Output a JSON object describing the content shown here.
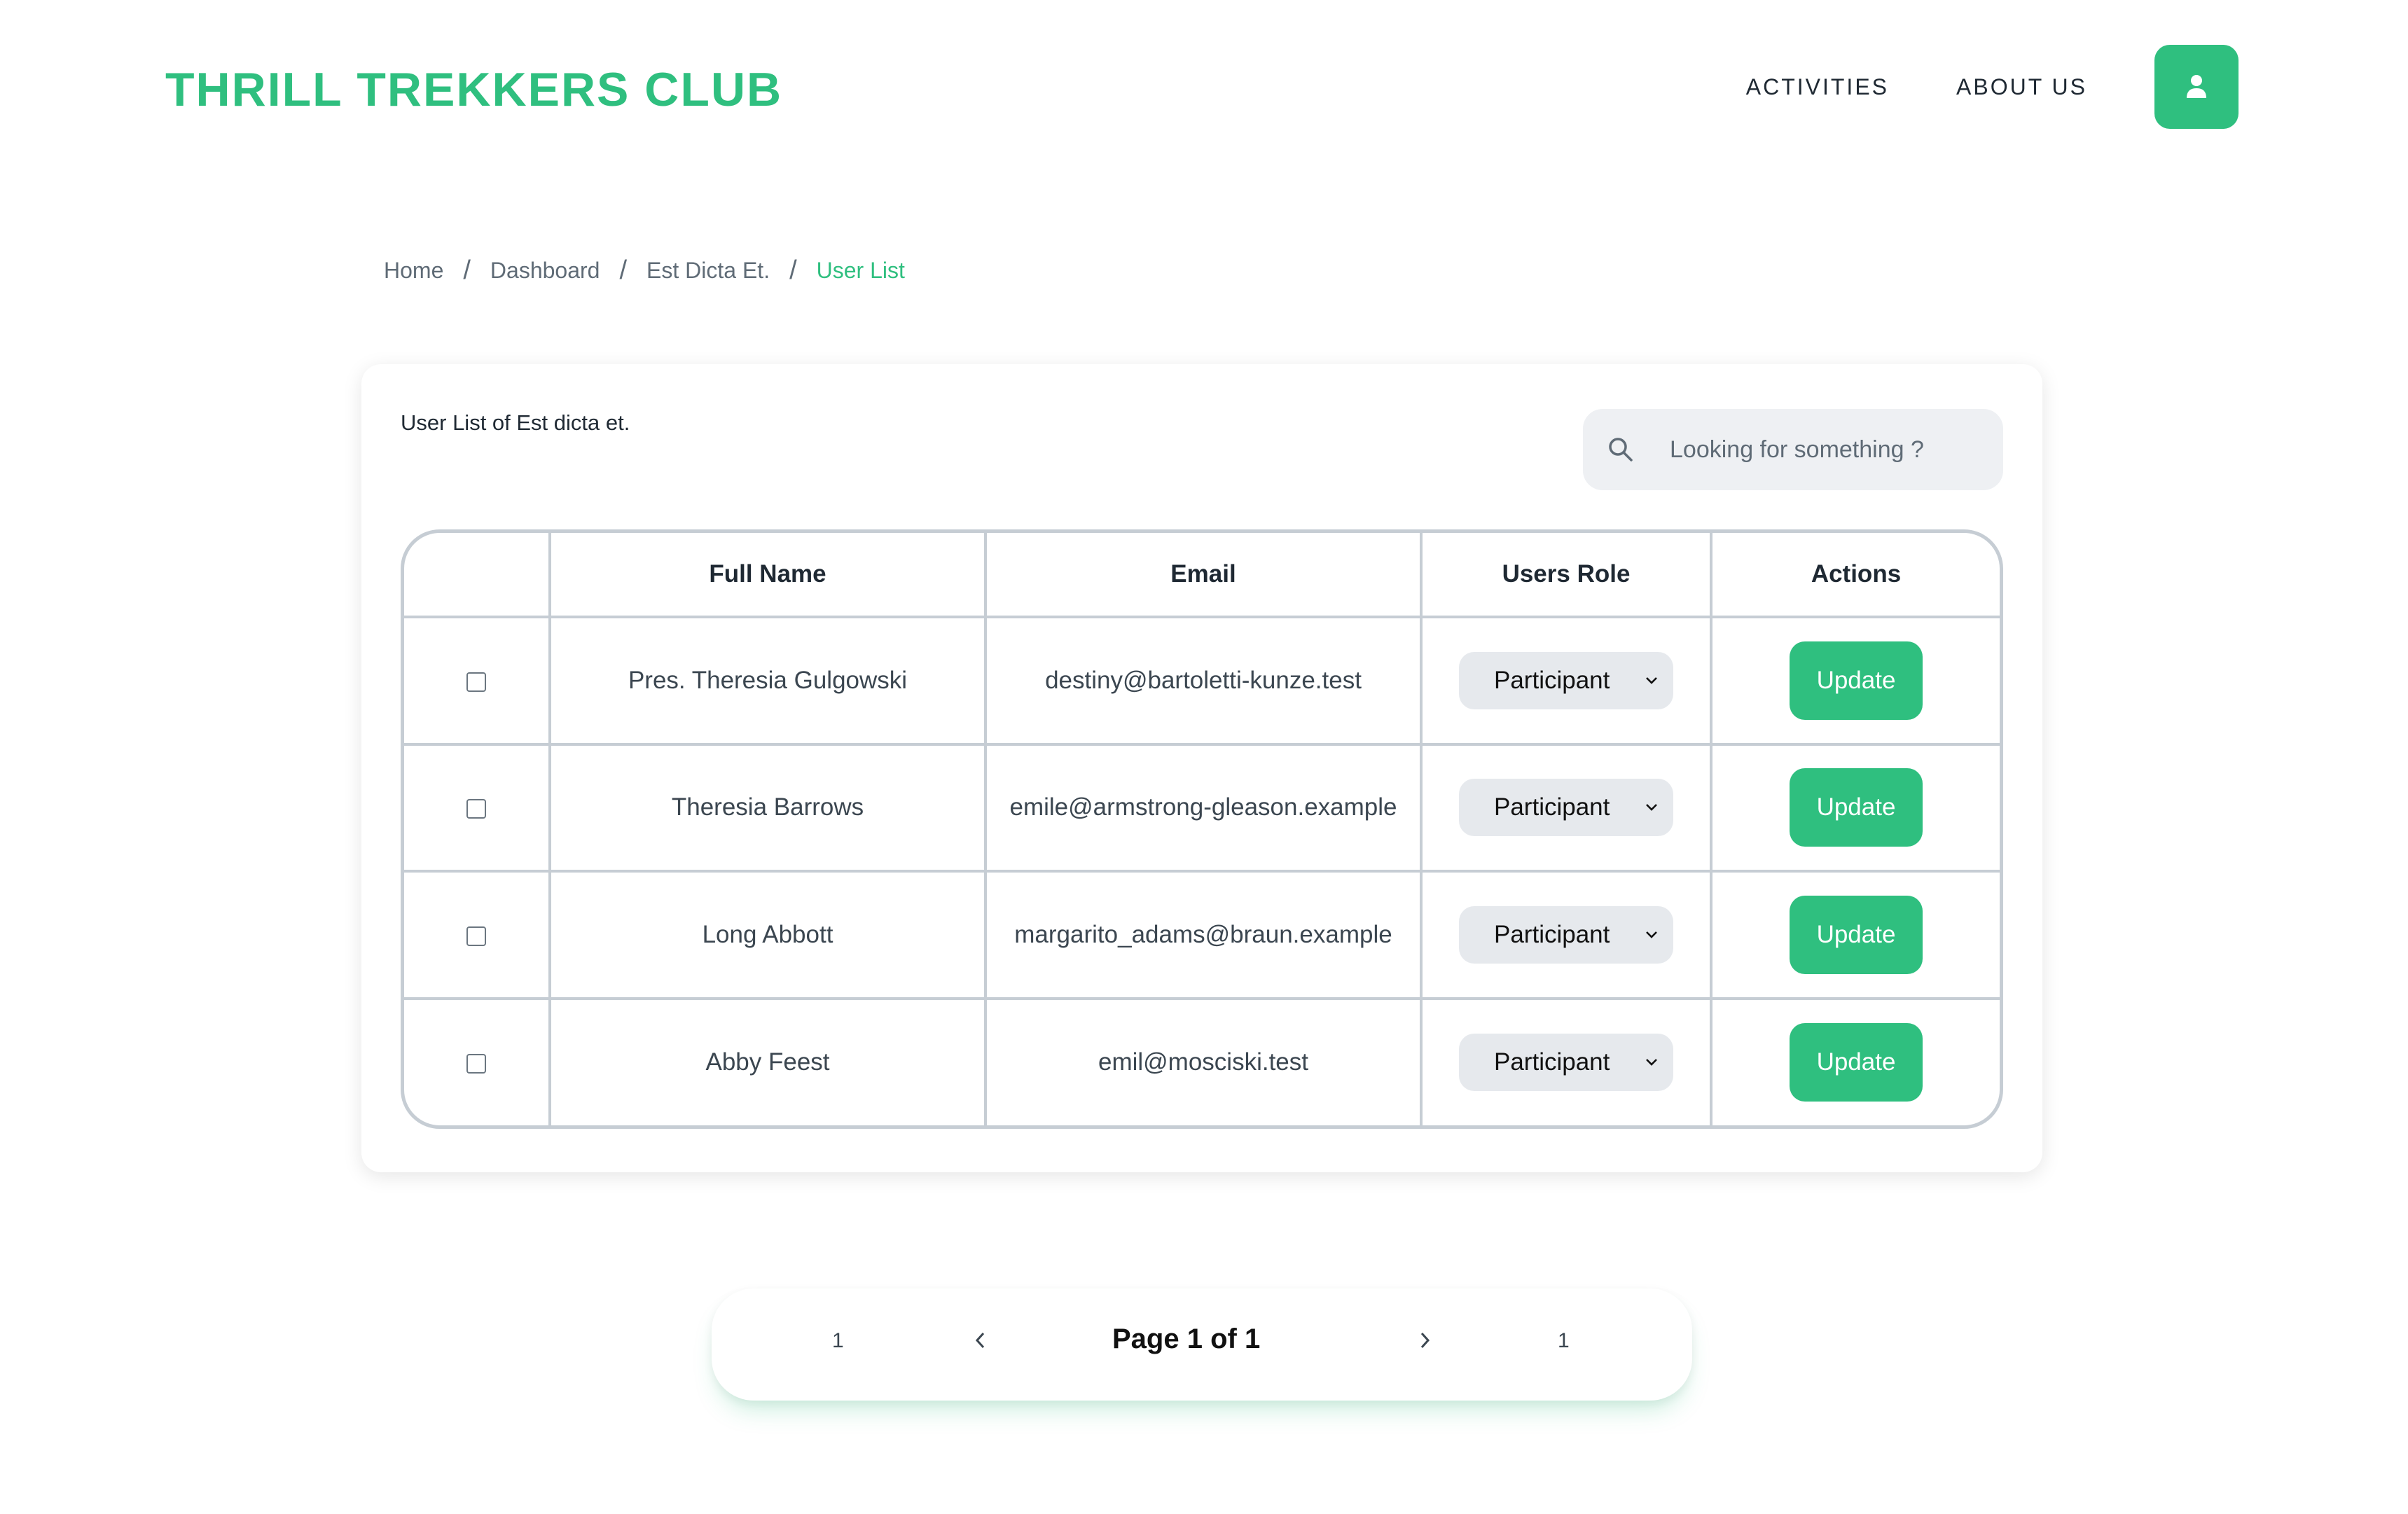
{
  "header": {
    "brand": "THRILL TREKKERS CLUB",
    "nav": [
      "ACTIVITIES",
      "ABOUT US"
    ],
    "user_icon": "user-icon",
    "accent_color": "#2fbf7f"
  },
  "breadcrumb": [
    "Home",
    "Dashboard",
    "Est Dicta Et.",
    "User List"
  ],
  "card": {
    "title": "User List of Est dicta et.",
    "search_placeholder": "Looking for something ?",
    "search_icon": "search-icon"
  },
  "table": {
    "headers": [
      "",
      "Full Name",
      "Email",
      "Users Role",
      "Actions"
    ],
    "rows": [
      {
        "name": "Pres. Theresia Gulgowski",
        "email": "destiny@bartoletti-kunze.test",
        "role": "Participant",
        "action": "Update"
      },
      {
        "name": "Theresia Barrows",
        "email": "emile@armstrong-gleason.example",
        "role": "Participant",
        "action": "Update"
      },
      {
        "name": "Long Abbott",
        "email": "margarito_adams@braun.example",
        "role": "Participant",
        "action": "Update"
      },
      {
        "name": "Abby Feest",
        "email": "emil@mosciski.test",
        "role": "Participant",
        "action": "Update"
      }
    ]
  },
  "pagination": {
    "first": "1",
    "label": "Page 1 of 1",
    "last": "1"
  }
}
